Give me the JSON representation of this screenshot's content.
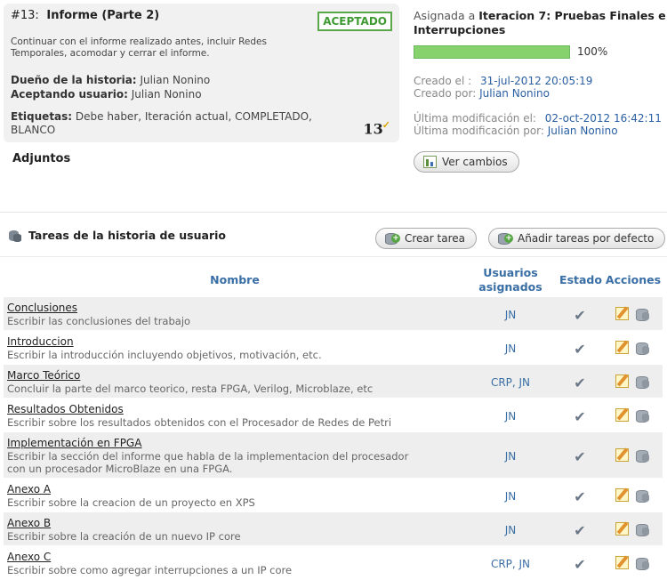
{
  "story": {
    "number": "#13:",
    "title": "Informe (Parte 2)",
    "status": "ACEPTADO",
    "description": "Continuar con el informe realizado antes, incluir Redes Temporales, acomodar y cerrar el informe.",
    "owner_label": "Dueño de la historia:",
    "owner_value": "Julian Nonino",
    "accepting_label": "Aceptando usuario:",
    "accepting_value": "Julian Nonino",
    "tags_label": "Etiquetas:",
    "tags_value": "Debe haber, Iteración actual, COMPLETADO, BLANCO",
    "points": "13",
    "attachments_label": "Adjuntos"
  },
  "side": {
    "assigned_prefix": "Asignada a",
    "iteration": "Iteracion 7: Pruebas Finales e Interrupciones",
    "progress_percent": 100,
    "progress_label": "100%",
    "created_label": "Creado el :",
    "created_value": "31-jul-2012 20:05:19",
    "created_by_label": "Creado por:",
    "created_by_value": "Julian Nonino",
    "modified_label": "Última modificación el:",
    "modified_value": "02-oct-2012 16:42:11",
    "modified_by_label": "Última modificación por:",
    "modified_by_value": "Julian Nonino",
    "changes_button": "Ver cambios"
  },
  "tasks": {
    "title": "Tareas de la historia de usuario",
    "create_button": "Crear tarea",
    "add_default_button": "Añadir tareas por defecto",
    "headers": {
      "name": "Nombre",
      "users": "Usuarios asignados",
      "state": "Estado",
      "actions": "Acciones"
    },
    "rows": [
      {
        "name": "Conclusiones",
        "desc": "Escribir las conclusiones del trabajo",
        "users": "JN"
      },
      {
        "name": "Introduccion",
        "desc": "Escribir la introducción incluyendo objetivos, motivación, etc.",
        "users": "JN"
      },
      {
        "name": "Marco Teórico",
        "desc": "Concluir la parte del marco teorico, resta FPGA, Verilog, Microblaze, etc",
        "users": "CRP, JN"
      },
      {
        "name": "Resultados Obtenidos",
        "desc": "Escribir sobre los resultados obtenidos con el Procesador de Redes de Petri",
        "users": "JN"
      },
      {
        "name": "Implementación en FPGA",
        "desc": "Escribir la sección del informe que habla de la implementacion del procesador con un procesador MicroBlaze en una FPGA.",
        "users": "JN"
      },
      {
        "name": "Anexo A",
        "desc": "Escribir sobre la creacion de un proyecto en XPS",
        "users": "JN"
      },
      {
        "name": "Anexo B",
        "desc": "Escribir sobre la creación de un nuevo IP core",
        "users": "JN"
      },
      {
        "name": "Anexo C",
        "desc": "Escribir sobre como agregar interrupciones a un IP core",
        "users": "CRP, JN"
      }
    ]
  }
}
